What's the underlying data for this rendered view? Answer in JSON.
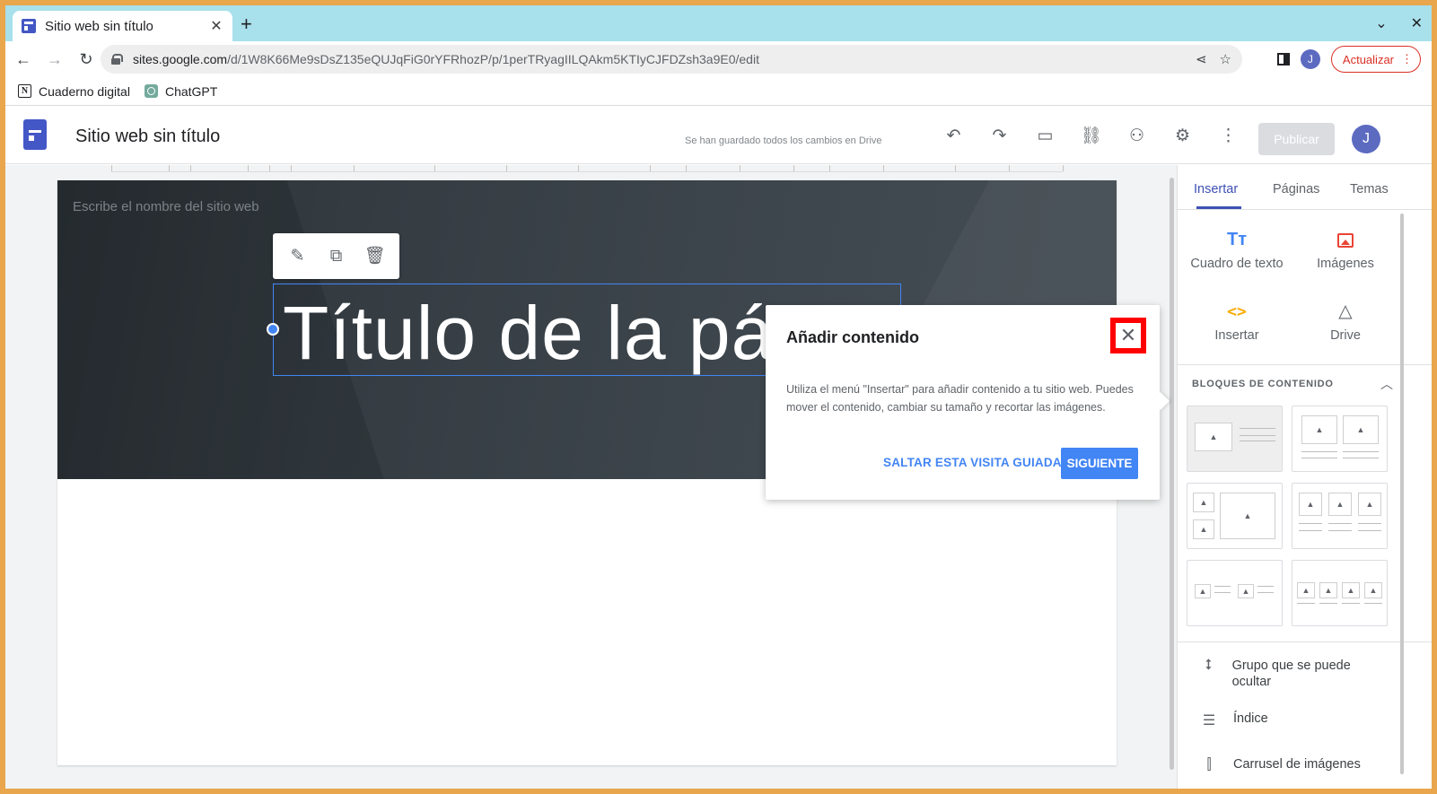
{
  "browser": {
    "tab_title": "Sitio web sin título",
    "tab_close": "✕",
    "new_tab": "+",
    "url_domain": "sites.google.com",
    "url_path": "/d/1W8K66Me9sDsZ135eQUJqFiG0rYFRhozP/p/1perTRyagIILQAkm5KTIyCJFDZsh3a9E0/edit",
    "update_label": "Actualizar",
    "profile_initial": "J",
    "bookmarks": [
      {
        "label": "Cuaderno digital",
        "icon": "notion-icon"
      },
      {
        "label": "ChatGPT",
        "icon": "chatgpt-icon"
      }
    ]
  },
  "header": {
    "site_title": "Sitio web sin título",
    "save_status": "Se han guardado todos los cambios en Drive",
    "publish_label": "Publicar",
    "avatar_initial": "J"
  },
  "canvas": {
    "site_name_placeholder": "Escribe el nombre del sitio web",
    "page_title": "Título de la pág"
  },
  "popup": {
    "title": "Añadir contenido",
    "body": "Utiliza el menú \"Insertar\" para añadir contenido a tu sitio web. Puedes mover el contenido, cambiar su tamaño y recortar las imágenes.",
    "skip_label": "SALTAR ESTA VISITA GUIADA",
    "next_label": "SIGUIENTE",
    "close_highlight_color": "#ff0000"
  },
  "panel": {
    "tabs": [
      {
        "label": "Insertar",
        "active": true
      },
      {
        "label": "Páginas",
        "active": false
      },
      {
        "label": "Temas",
        "active": false
      }
    ],
    "insert_items": [
      {
        "label": "Cuadro de texto",
        "icon": "text-box-icon"
      },
      {
        "label": "Imágenes",
        "icon": "image-icon"
      },
      {
        "label": "Insertar",
        "icon": "embed-icon"
      },
      {
        "label": "Drive",
        "icon": "drive-icon"
      }
    ],
    "blocks_header": "BLOQUES DE CONTENIDO",
    "extra_items": [
      {
        "label": "Grupo que se puede ocultar",
        "icon": "collapsible-group-icon"
      },
      {
        "label": "Índice",
        "icon": "table-of-contents-icon"
      },
      {
        "label": "Carrusel de imágenes",
        "icon": "image-carousel-icon"
      }
    ]
  },
  "colors": {
    "accent": "#4285f4",
    "sites_brand": "#3f51b5",
    "tabstrip": "#a8e0ec"
  }
}
